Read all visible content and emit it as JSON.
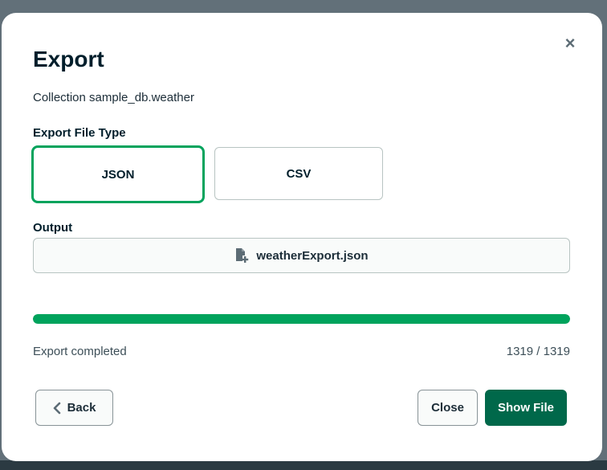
{
  "modal": {
    "title": "Export",
    "subtitle": "Collection sample_db.weather",
    "close_glyph": "×"
  },
  "file_type": {
    "label": "Export File Type",
    "options": [
      {
        "label": "JSON",
        "selected": true
      },
      {
        "label": "CSV",
        "selected": false
      }
    ]
  },
  "output": {
    "label": "Output",
    "filename": "weatherExport.json",
    "icon": "file-add-icon"
  },
  "progress": {
    "fraction": 1.0,
    "status": "Export completed",
    "count": "1319 / 1319",
    "color": "#00a35c"
  },
  "footer": {
    "back_label": "Back",
    "close_label": "Close",
    "show_file_label": "Show File"
  },
  "colors": {
    "accent": "#00a35c",
    "primary_button": "#00684a",
    "backdrop": "#627079"
  }
}
